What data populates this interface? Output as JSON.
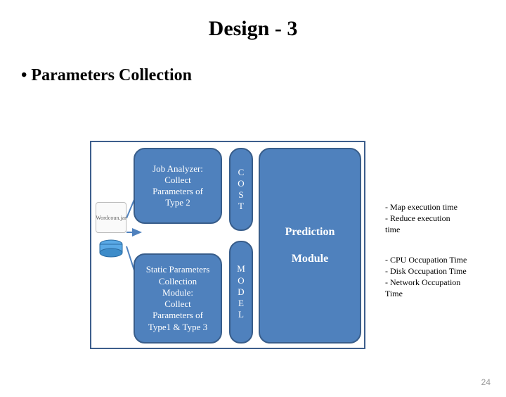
{
  "title": "Design - 3",
  "bullet": "Parameters Collection",
  "icons": {
    "jar": "Wordcoun.jar",
    "disk": "disk-icon"
  },
  "boxes": {
    "job": "Job Analyzer:\nCollect\nParameters of\nType 2",
    "static": "Static Parameters\nCollection\nModule:\nCollect\nParameters of\nType1 & Type 3",
    "cost_a": "C\nO\nS\nT",
    "cost_b": "M\nO\nD\nE\nL",
    "pred_top": "Prediction",
    "pred_bottom": "Module"
  },
  "outputs": {
    "a": "- Map execution time\n- Reduce execution\ntime",
    "b": "- CPU Occupation Time\n- Disk Occupation Time\n- Network Occupation\nTime"
  },
  "slide_number": "24"
}
